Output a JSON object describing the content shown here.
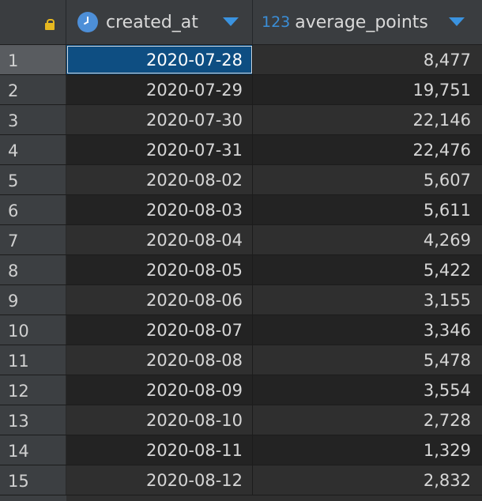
{
  "header": {
    "col1": {
      "label": "created_at",
      "icon": "clock-icon"
    },
    "col2": {
      "label": "average_points",
      "type_prefix": "123"
    },
    "rownum_icon": "lock-icon"
  },
  "selected_row": 1,
  "rows": [
    {
      "n": "1",
      "created_at": "2020-07-28",
      "average_points": "8,477"
    },
    {
      "n": "2",
      "created_at": "2020-07-29",
      "average_points": "19,751"
    },
    {
      "n": "3",
      "created_at": "2020-07-30",
      "average_points": "22,146"
    },
    {
      "n": "4",
      "created_at": "2020-07-31",
      "average_points": "22,476"
    },
    {
      "n": "5",
      "created_at": "2020-08-02",
      "average_points": "5,607"
    },
    {
      "n": "6",
      "created_at": "2020-08-03",
      "average_points": "5,611"
    },
    {
      "n": "7",
      "created_at": "2020-08-04",
      "average_points": "4,269"
    },
    {
      "n": "8",
      "created_at": "2020-08-05",
      "average_points": "5,422"
    },
    {
      "n": "9",
      "created_at": "2020-08-06",
      "average_points": "3,155"
    },
    {
      "n": "10",
      "created_at": "2020-08-07",
      "average_points": "3,346"
    },
    {
      "n": "11",
      "created_at": "2020-08-08",
      "average_points": "5,478"
    },
    {
      "n": "12",
      "created_at": "2020-08-09",
      "average_points": "3,554"
    },
    {
      "n": "13",
      "created_at": "2020-08-10",
      "average_points": "2,728"
    },
    {
      "n": "14",
      "created_at": "2020-08-11",
      "average_points": "1,329"
    },
    {
      "n": "15",
      "created_at": "2020-08-12",
      "average_points": "2,832"
    }
  ]
}
